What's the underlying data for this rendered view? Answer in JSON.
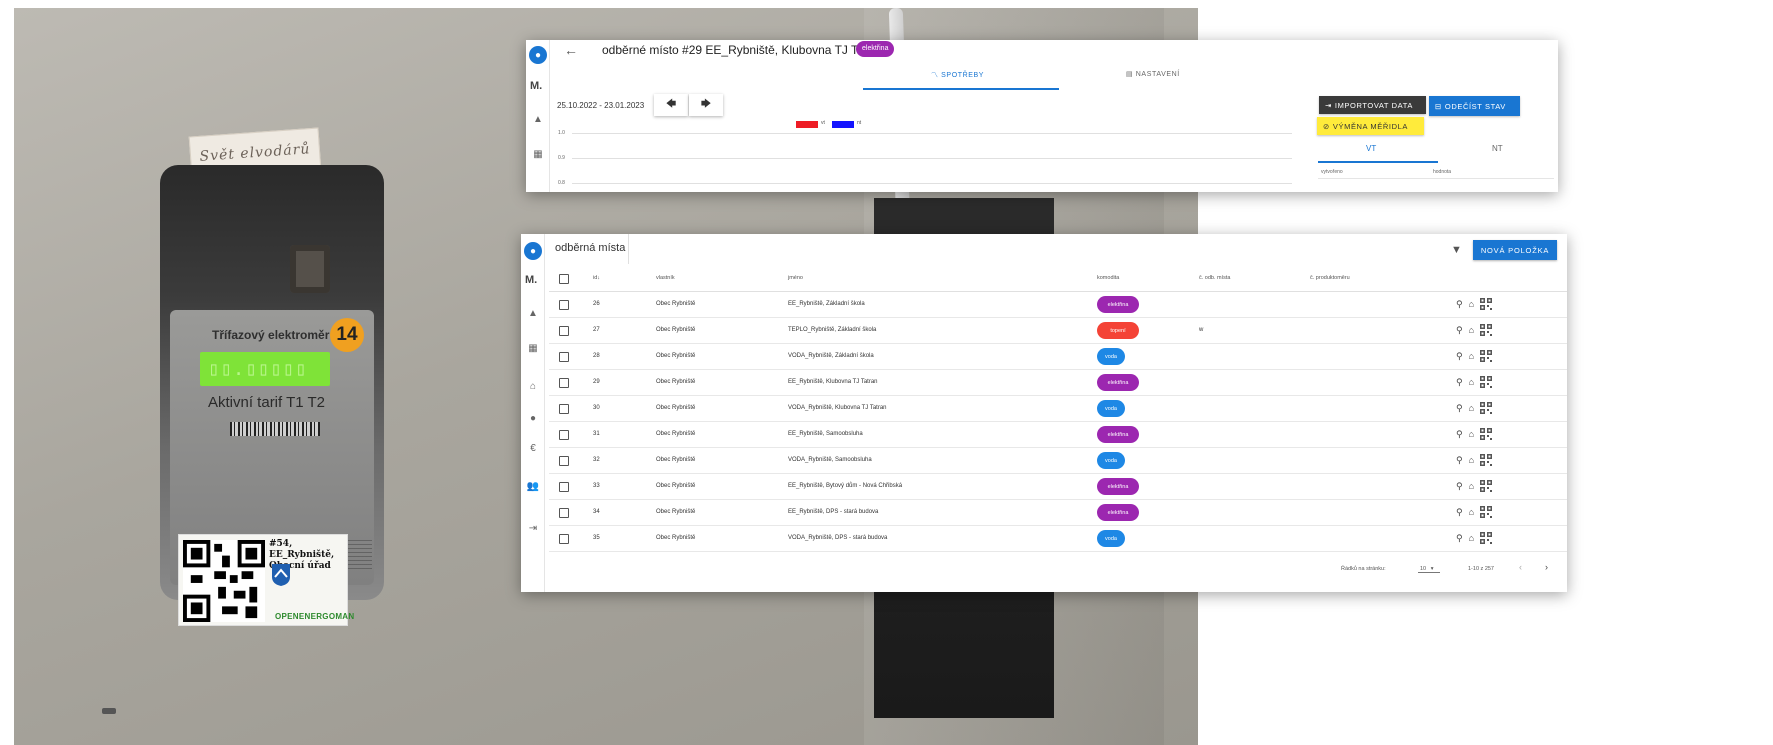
{
  "photo": {
    "handwritten_label": "Svět elvodárů",
    "meter": {
      "title": "Třífazový elektroměr",
      "badge": "14",
      "tarif": "Aktivní tarif  T1 T2"
    },
    "sticker": {
      "text": "#54, EE_Rybniště, Obecní úřad",
      "brand": "OPENENERGOMAN"
    }
  },
  "detail": {
    "title": "odběrné místo #29 EE_Rybniště, Klubovna TJ Tatran",
    "chip": "elektřina",
    "tabs": [
      {
        "label": "SPOTŘEBY",
        "icon": "chart-line-icon",
        "active": true
      },
      {
        "label": "NASTAVENÍ",
        "icon": "settings-list-icon",
        "active": false
      }
    ],
    "date_range": "25.10.2022 - 23.01.2023",
    "legend": [
      {
        "label": "vt",
        "color": "#ee1c25"
      },
      {
        "label": "nt",
        "color": "#1414ff"
      }
    ],
    "y_ticks": [
      "1.0",
      "0.9",
      "0.8"
    ],
    "buttons": {
      "import": "IMPORTOVAT DATA",
      "odecist": "ODEČÍST STAV",
      "vymena": "VÝMĚNA MĚŘIDLA"
    },
    "subtabs": {
      "vt": "VT",
      "nt": "NT"
    },
    "subtable_headers": {
      "created": "vytvořeno",
      "value": "hodnota"
    }
  },
  "list": {
    "title": "odběrná místa",
    "new_button": "NOVÁ POLOŽKA",
    "headers": {
      "id": "id↓",
      "owner": "vlastník",
      "name": "jméno",
      "commodity": "komodita",
      "place_no": "č. odb. místa",
      "meter_no": "č. produktoměru"
    },
    "rows": [
      {
        "id": "26",
        "owner": "Obec Rybniště",
        "name": "EE_Rybniště, Základní škola",
        "commodity": "elektřina",
        "place_no": ""
      },
      {
        "id": "27",
        "owner": "Obec Rybniště",
        "name": "TEPLO_Rybniště, Základní škola",
        "commodity": "topení",
        "place_no": "w"
      },
      {
        "id": "28",
        "owner": "Obec Rybniště",
        "name": "VODA_Rybniště, Základní škola",
        "commodity": "voda",
        "place_no": ""
      },
      {
        "id": "29",
        "owner": "Obec Rybniště",
        "name": "EE_Rybniště, Klubovna TJ Tatran",
        "commodity": "elektřina",
        "place_no": ""
      },
      {
        "id": "30",
        "owner": "Obec Rybniště",
        "name": "VODA_Rybniště, Klubovna TJ Tatran",
        "commodity": "voda",
        "place_no": ""
      },
      {
        "id": "31",
        "owner": "Obec Rybniště",
        "name": "EE_Rybniště, Samoobsluha",
        "commodity": "elektřina",
        "place_no": ""
      },
      {
        "id": "32",
        "owner": "Obec Rybniště",
        "name": "VODA_Rybniště, Samoobsluha",
        "commodity": "voda",
        "place_no": ""
      },
      {
        "id": "33",
        "owner": "Obec Rybniště",
        "name": "EE_Rybniště, Bytový dům - Nová Chřibská",
        "commodity": "elektřina",
        "place_no": ""
      },
      {
        "id": "34",
        "owner": "Obec Rybniště",
        "name": "EE_Rybniště, DPS - stará budova",
        "commodity": "elektřina",
        "place_no": ""
      },
      {
        "id": "35",
        "owner": "Obec Rybniště",
        "name": "VODA_Rybniště, DPS - stará budova",
        "commodity": "voda",
        "place_no": ""
      }
    ],
    "footer": {
      "rows_per_page_label": "Řádků na stránku:",
      "rows_per_page": "10",
      "range": "1-10 z 257"
    }
  },
  "colors": {
    "primary": "#1976d2",
    "elektrina": "#9c27b0",
    "topeni": "#f44336",
    "voda": "#1e88e5",
    "warning": "#ffeb3b"
  },
  "rail": {
    "avatar_icon": "user-icon",
    "letter": "M.",
    "icons": [
      "bell-icon",
      "dashboard-icon",
      "home-icon",
      "help-icon",
      "euro-icon",
      "users-icon",
      "logout-icon"
    ]
  }
}
